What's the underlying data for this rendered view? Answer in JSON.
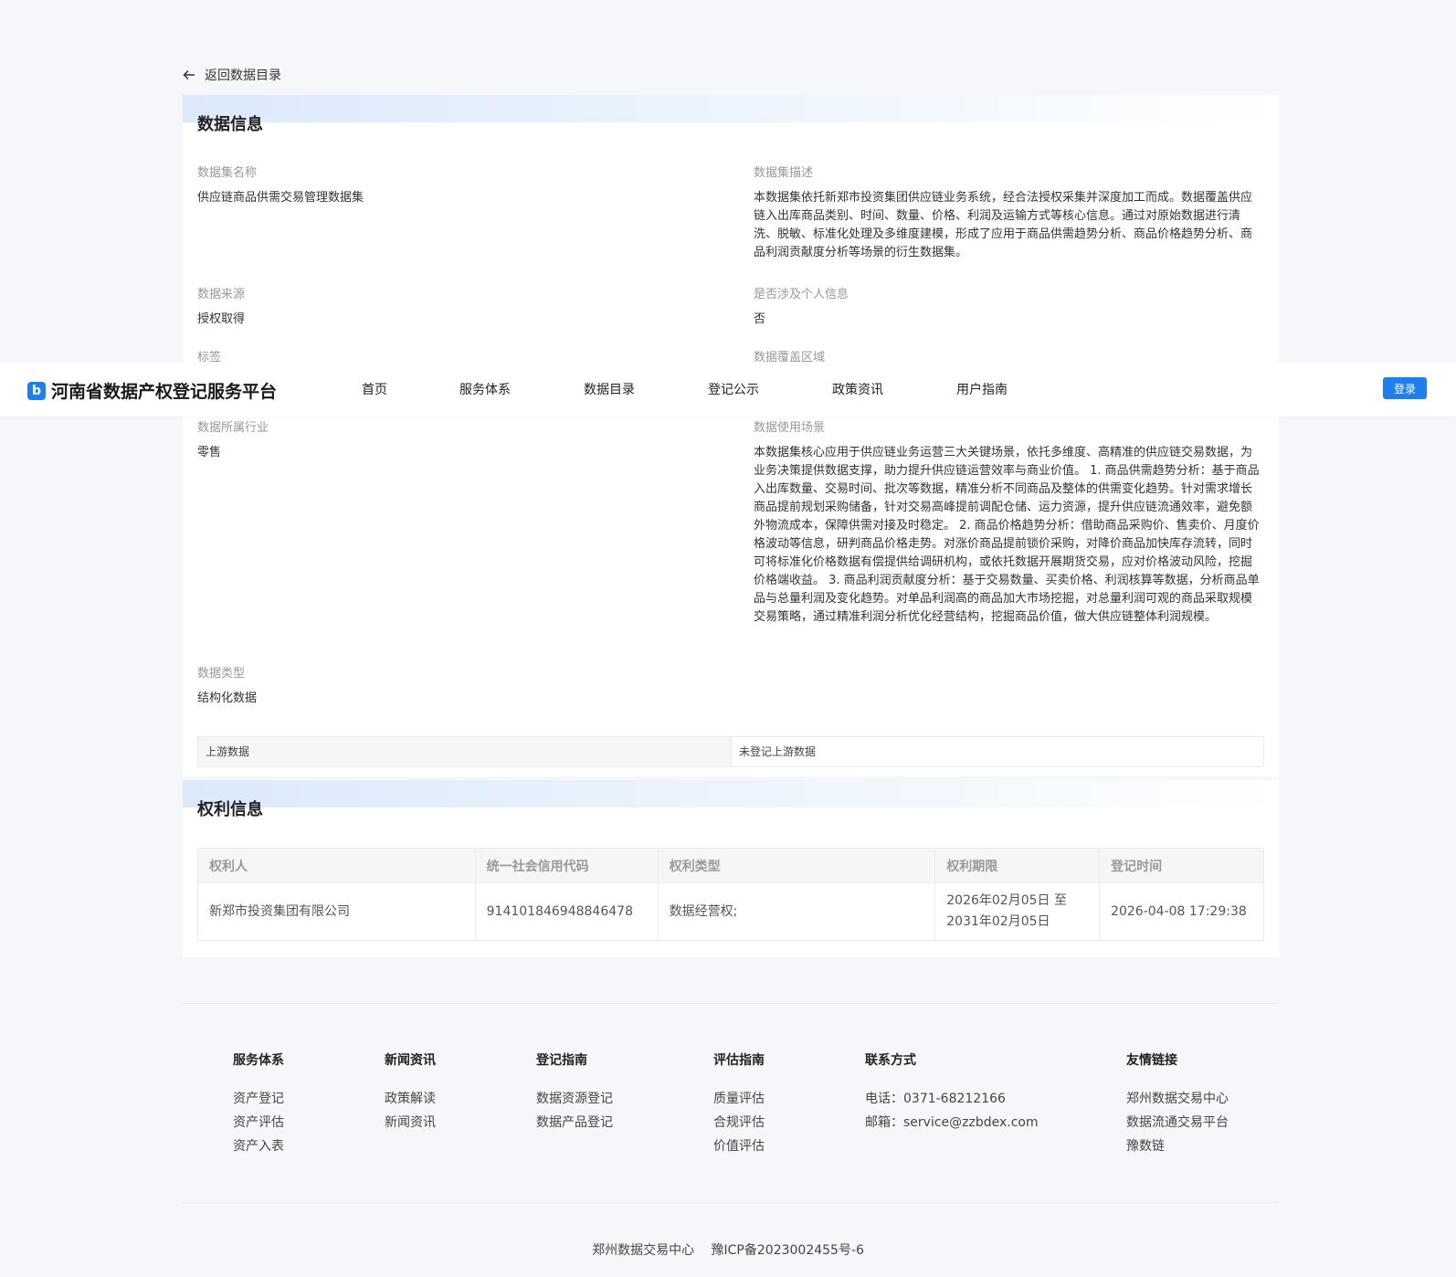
{
  "back_link": "返回数据目录",
  "data_info": {
    "title": "数据信息",
    "fields": [
      {
        "label": "数据集名称",
        "value": "供应链商品供需交易管理数据集"
      },
      {
        "label": "数据集描述",
        "value": "本数据集依托新郑市投资集团供应链业务系统，经合法授权采集并深度加工而成。数据覆盖供应链入出库商品类别、时间、数量、价格、利润及运输方式等核心信息。通过对原始数据进行清洗、脱敏、标准化处理及多维度建模，形成了应用于商品供需趋势分析、商品价格趋势分析、商品利润贡献度分析等场景的衍生数据集。"
      },
      {
        "label": "数据来源",
        "value": "授权取得"
      },
      {
        "label": "是否涉及个人信息",
        "value": "否"
      },
      {
        "label": "标签",
        "value": ""
      },
      {
        "label": "数据覆盖区域",
        "value": ""
      },
      {
        "label": "数据所属行业",
        "value": "零售"
      },
      {
        "label": "数据使用场景",
        "value": "本数据集核心应用于供应链业务运营三大关键场景，依托多维度、高精准的供应链交易数据，为业务决策提供数据支撑，助力提升供应链运营效率与商业价值。 1. 商品供需趋势分析：基于商品入出库数量、交易时间、批次等数据，精准分析不同商品及整体的供需变化趋势。针对需求增长商品提前规划采购储备，针对交易高峰提前调配仓储、运力资源，提升供应链流通效率，避免额外物流成本，保障供需对接及时稳定。 2. 商品价格趋势分析：借助商品采购价、售卖价、月度价格波动等信息，研判商品价格走势。对涨价商品提前锁价采购，对降价商品加快库存流转，同时可将标准化价格数据有偿提供给调研机构，或依托数据开展期货交易，应对价格波动风险，挖掘价格端收益。 3. 商品利润贡献度分析：基于交易数量、买卖价格、利润核算等数据，分析商品单品与总量利润及变化趋势。对单品利润高的商品加大市场挖掘，对总量利润可观的商品采取规模交易策略，通过精准利润分析优化经营结构，挖掘商品价值，做大供应链整体利润规模。"
      },
      {
        "label": "数据类型",
        "value": "结构化数据"
      }
    ],
    "upstream_label": "上游数据",
    "upstream_value": "未登记上游数据"
  },
  "rights_info": {
    "title": "权利信息",
    "columns": [
      "权利人",
      "统一社会信用代码",
      "权利类型",
      "权利期限",
      "登记时间"
    ],
    "rows": [
      [
        "新郑市投资集团有限公司",
        "914101846948846478",
        "数据经营权;",
        "2026年02月05日 至 2031年02月05日",
        "2026-04-08 17:29:38"
      ]
    ]
  },
  "navbar": {
    "logo_glyph": "b",
    "brand": "河南省数据产权登记服务平台",
    "items": [
      "首页",
      "服务体系",
      "数据目录",
      "登记公示",
      "政策资讯",
      "用户指南"
    ],
    "login": "登录"
  },
  "footer": {
    "columns": [
      {
        "title": "服务体系",
        "items": [
          "资产登记",
          "资产评估",
          "资产入表"
        ]
      },
      {
        "title": "新闻资讯",
        "items": [
          "政策解读",
          "新闻资讯"
        ]
      },
      {
        "title": "登记指南",
        "items": [
          "数据资源登记",
          "数据产品登记"
        ]
      },
      {
        "title": "评估指南",
        "items": [
          "质量评估",
          "合规评估",
          "价值评估"
        ]
      },
      {
        "title": "联系方式",
        "items": [
          "电话：0371-68212166",
          "邮箱：service@zzbdex.com"
        ]
      },
      {
        "title": "友情链接",
        "items": [
          "郑州数据交易中心",
          "数据流通交易平台",
          "豫数链"
        ]
      }
    ],
    "copyright_org": "郑州数据交易中心",
    "icp": "豫ICP备2023002455号-6"
  },
  "colors": {
    "accent": "#1e7ff0",
    "page_bg": "#f5f7fb"
  }
}
